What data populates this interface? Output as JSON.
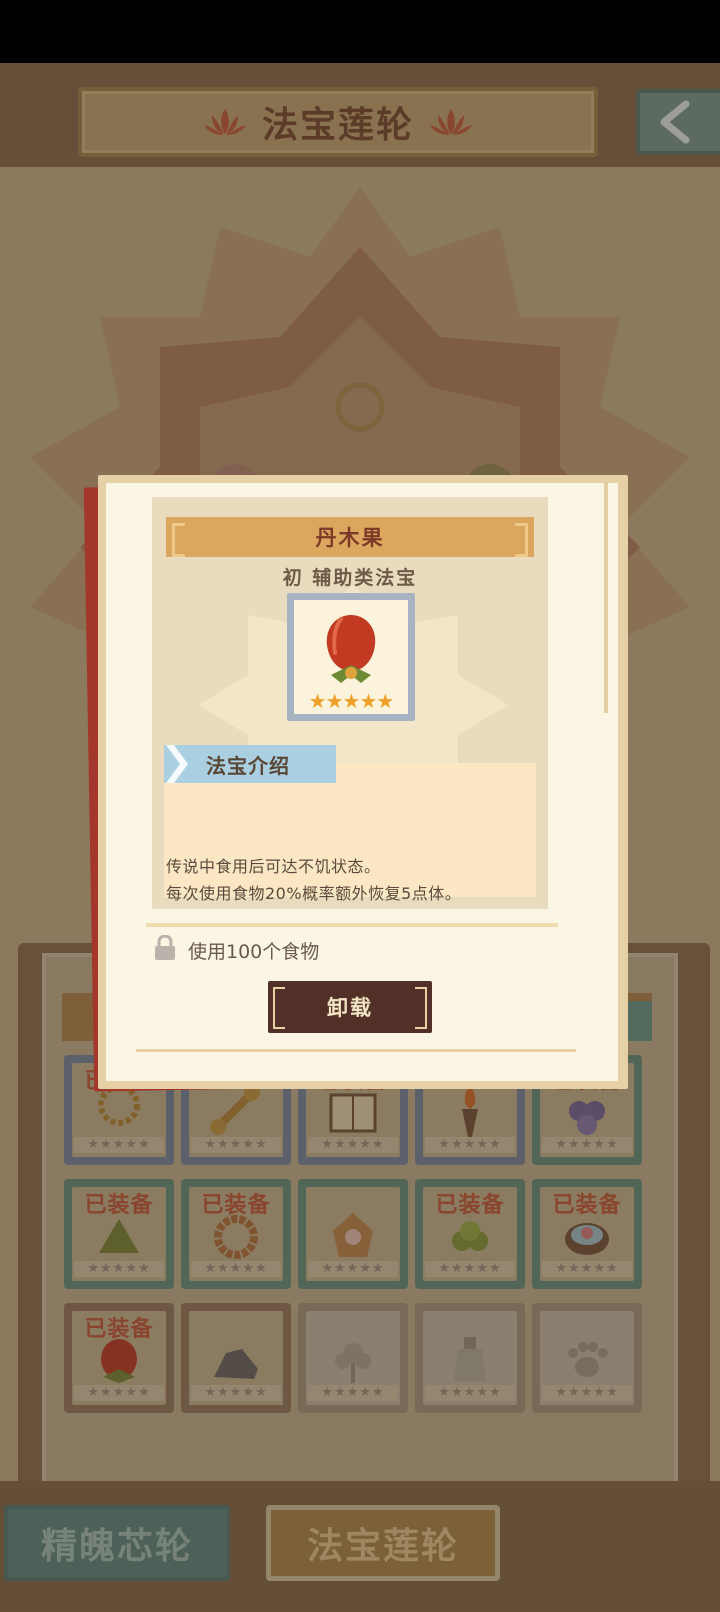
{
  "header": {
    "title": "法宝莲轮"
  },
  "inventory": {
    "slots": [
      {
        "equipped_label": "已装备",
        "stars": "★★★★★",
        "frame": "blue",
        "icon": "necklace-icon",
        "state": "equipped"
      },
      {
        "equipped_label": "",
        "stars": "★★★★★",
        "frame": "blue",
        "icon": "vajra-icon",
        "state": "normal"
      },
      {
        "equipped_label": "已装备",
        "stars": "★★★★★",
        "frame": "blue",
        "icon": "scroll-icon",
        "state": "equipped"
      },
      {
        "equipped_label": "",
        "stars": "★★★★★",
        "frame": "blue",
        "icon": "torch-icon",
        "state": "normal"
      },
      {
        "equipped_label": "已装备",
        "stars": "★★★★★",
        "frame": "teal",
        "icon": "grapes-icon",
        "state": "equipped"
      },
      {
        "equipped_label": "已装备",
        "stars": "★★★★★",
        "frame": "teal",
        "icon": "leaf-bundle-icon",
        "state": "equipped"
      },
      {
        "equipped_label": "已装备",
        "stars": "★★★★★",
        "frame": "teal",
        "icon": "bead-bracelet-icon",
        "state": "equipped"
      },
      {
        "equipped_label": "",
        "stars": "★★★★★",
        "frame": "teal",
        "icon": "pouch-icon",
        "state": "normal"
      },
      {
        "equipped_label": "已装备",
        "stars": "★★★★★",
        "frame": "teal",
        "icon": "olives-icon",
        "state": "equipped"
      },
      {
        "equipped_label": "已装备",
        "stars": "★★★★★",
        "frame": "teal",
        "icon": "bowl-icon",
        "state": "equipped"
      },
      {
        "equipped_label": "已装备",
        "stars": "★★★★★",
        "frame": "brown",
        "icon": "fruit-icon",
        "state": "equipped"
      },
      {
        "equipped_label": "",
        "stars": "★★★★★",
        "frame": "brown",
        "icon": "rock-icon",
        "state": "normal"
      },
      {
        "equipped_label": "",
        "stars": "★★★★★",
        "frame": "grey",
        "icon": "blossom-icon",
        "state": "locked"
      },
      {
        "equipped_label": "",
        "stars": "★★★★★",
        "frame": "grey",
        "icon": "bottle-icon",
        "state": "locked"
      },
      {
        "equipped_label": "",
        "stars": "★★★★★",
        "frame": "grey",
        "icon": "paw-icon",
        "state": "locked"
      }
    ]
  },
  "tabs": {
    "jingpo": "精魄芯轮",
    "fabao": "法宝莲轮"
  },
  "dialog": {
    "item_name": "丹木果",
    "item_rank": "初 辅助类法宝",
    "item_stars": "★★★★★",
    "section_label": "法宝介绍",
    "description_lines": [
      "传说中食用后可达不饥状态。",
      "每次使用食物20%概率额外恢复5点体。"
    ],
    "unlock_condition": "使用100个食物",
    "unequip_label": "卸载"
  },
  "colors": {
    "accent": "#dba65e",
    "equipped_text": "#c75e3e",
    "button_dark": "#523028",
    "star": "#f0a028"
  }
}
